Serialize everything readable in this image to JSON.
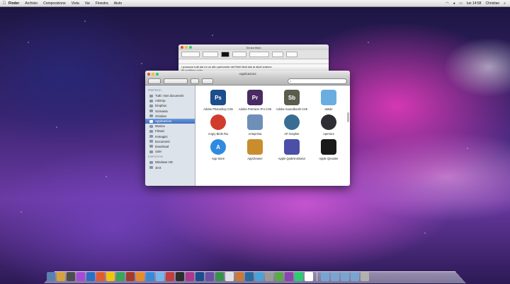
{
  "menubar": {
    "items": [
      "Finder",
      "Archivio",
      "Composizione",
      "Vista",
      "Vai",
      "Finestra",
      "Aiuto"
    ],
    "clock": "lun 14:58",
    "user": "Christian"
  },
  "textedit": {
    "title": "Senza titolo",
    "text_line1": "i possono tutti dai mi un alto parlomnte dei?Nell Mali sita ai disdi sotemo",
    "text_line2": "fiti mattitano tutto..."
  },
  "finder": {
    "title": "Applicazioni",
    "search_placeholder": "",
    "sidebar": {
      "header_devices": "DISPOSITIVI",
      "header_shared": "CONDIVISI",
      "items": [
        {
          "label": "Tutti i miei documenti",
          "selected": false
        },
        {
          "label": "AirDrop",
          "selected": false
        },
        {
          "label": "Dropbox",
          "selected": false
        },
        {
          "label": "Scrivania",
          "selected": false
        },
        {
          "label": "christian",
          "selected": false
        },
        {
          "label": "Applicazioni",
          "selected": true
        },
        {
          "label": "Musica",
          "selected": false
        },
        {
          "label": "Filmati",
          "selected": false
        },
        {
          "label": "Immagini",
          "selected": false
        },
        {
          "label": "Documenti",
          "selected": false
        },
        {
          "label": "Download",
          "selected": false
        },
        {
          "label": "cider",
          "selected": false
        }
      ],
      "devices": [
        {
          "label": "Windows HD"
        },
        {
          "label": "10.6"
        }
      ]
    },
    "apps": [
      {
        "label": "Adobe Photoshop CS5",
        "glyph": "Ps",
        "color": "#1c4d8c"
      },
      {
        "label": "Adobe Premiere Pro CS5",
        "glyph": "Pr",
        "color": "#4a2a63"
      },
      {
        "label": "Adobe Soundbooth CS5",
        "glyph": "Sb",
        "color": "#5b5b4e"
      },
      {
        "label": "aMule",
        "glyph": "",
        "color": "#6aaee0"
      },
      {
        "label": "Angry Birds Rio",
        "glyph": "",
        "color": "#d23c2c"
      },
      {
        "label": "Anteprima",
        "glyph": "",
        "color": "#6e8fb8"
      },
      {
        "label": "AP Grapher",
        "glyph": "",
        "color": "#3a6d94"
      },
      {
        "label": "Aperture",
        "glyph": "",
        "color": "#2d2d33"
      },
      {
        "label": "App Store",
        "glyph": "A",
        "color": "#2f8ae0"
      },
      {
        "label": "AppCleaner",
        "glyph": "",
        "color": "#c98d2e"
      },
      {
        "label": "Apple Qadministrator",
        "glyph": "",
        "color": "#4b4fa6"
      },
      {
        "label": "Apple Qmaster",
        "glyph": "",
        "color": "#1a1a1a"
      }
    ]
  },
  "dock": {
    "icon_colors": [
      "#5b7fb0",
      "#d6a23b",
      "#4d4d4d",
      "#a74bd6",
      "#2d6ec4",
      "#e25b2c",
      "#f1c40f",
      "#3aa55b",
      "#a43a2c",
      "#e58d2b",
      "#3a89d6",
      "#77b6e8",
      "#c23f3f",
      "#2d2d2d",
      "#aa3a8e",
      "#1c4d8c",
      "#6b4fa6",
      "#3b8f4e",
      "#e0e0e0",
      "#c87a36",
      "#2b6aa0",
      "#4aa3d6",
      "#9a9a9a",
      "#5ca84b",
      "#8e44ad",
      "#2ecc71",
      "#ffffff",
      "#7aa4cf",
      "#7aa4cf",
      "#7aa4cf",
      "#7aa4cf",
      "#b0b0b0"
    ]
  }
}
